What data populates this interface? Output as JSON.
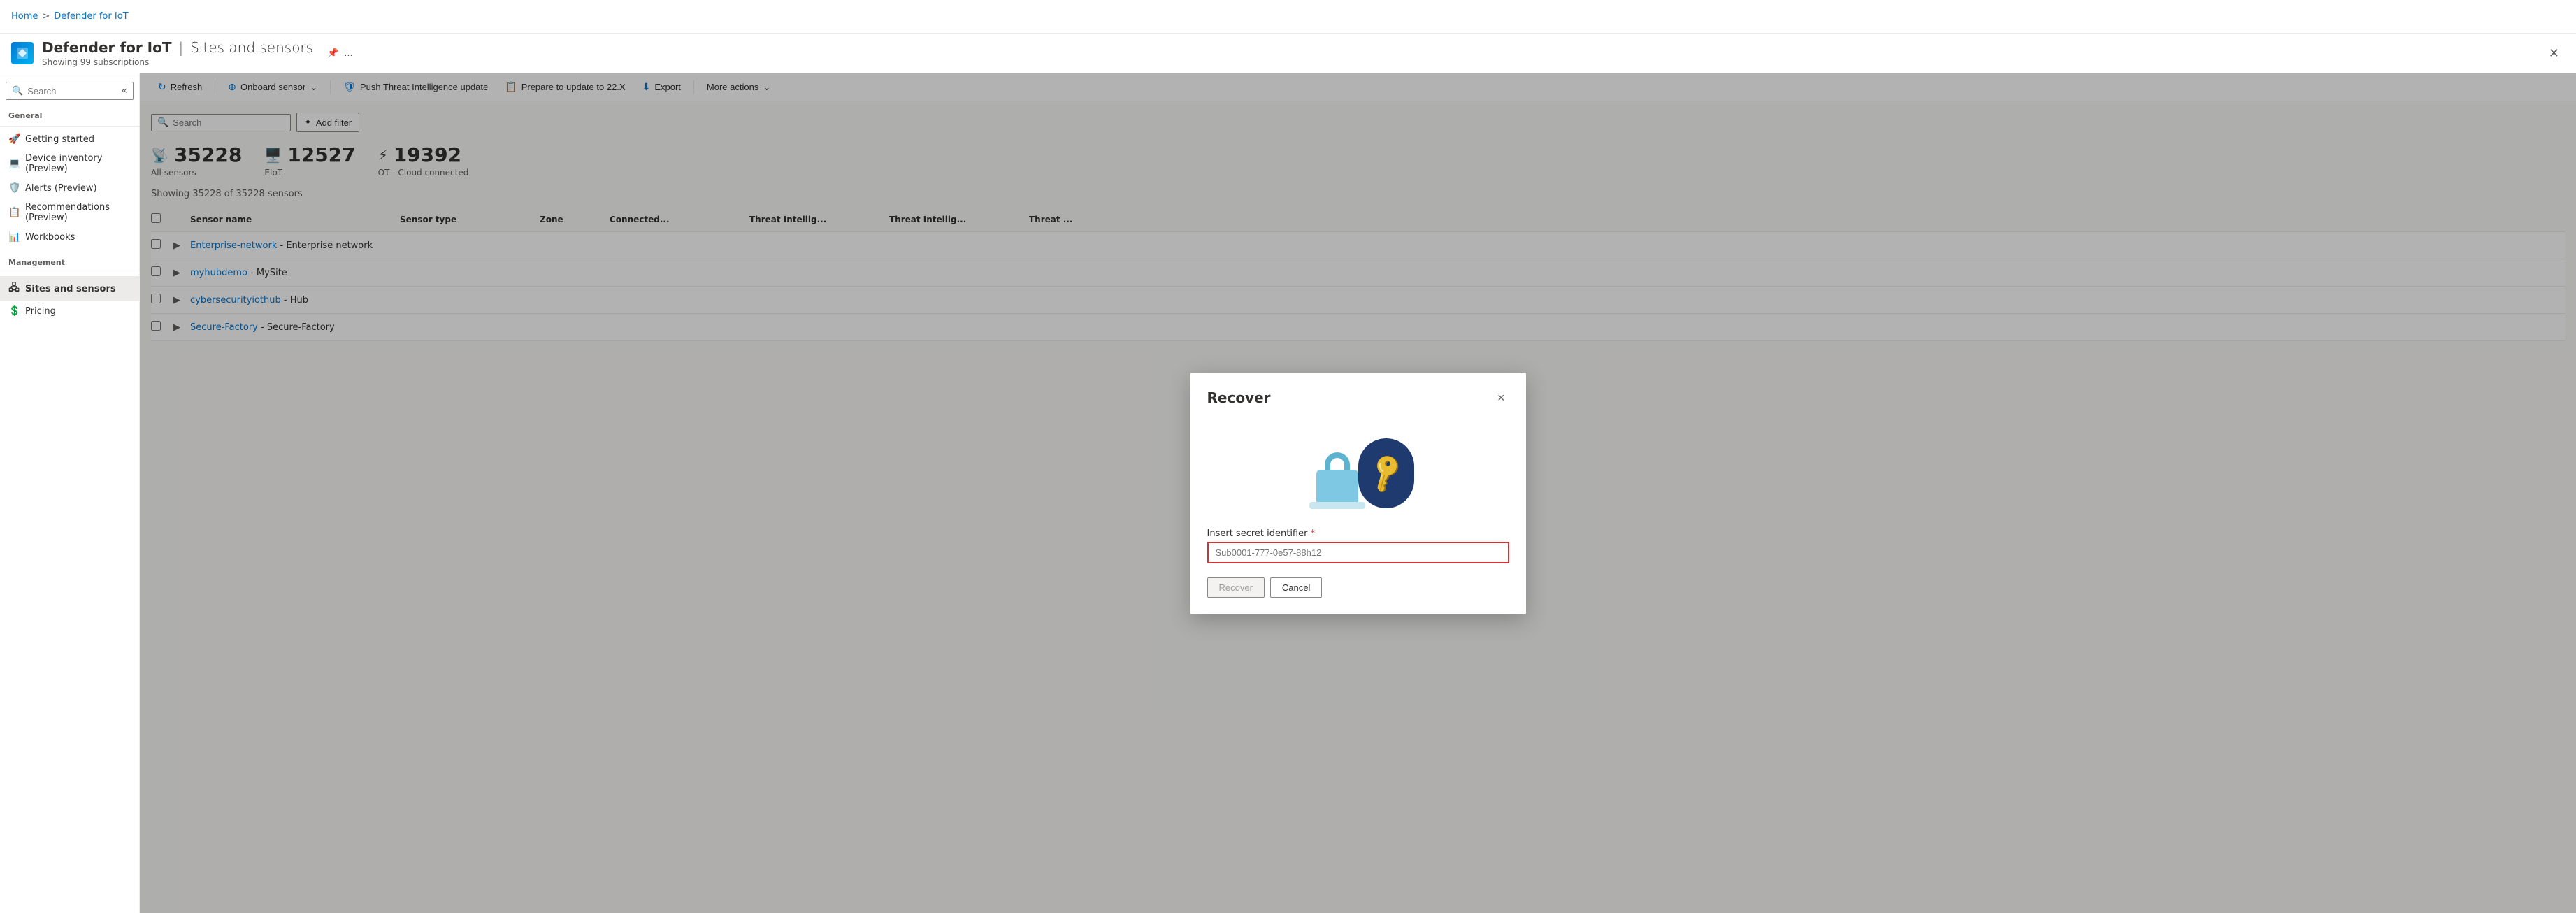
{
  "breadcrumb": {
    "home": "Home",
    "separator": ">",
    "current": "Defender for IoT"
  },
  "appTitle": {
    "name": "Defender for IoT",
    "divider": "|",
    "subtitle": "Sites and sensors",
    "subscriptions": "Showing 99 subscriptions",
    "pinIcon": "📌",
    "moreIcon": "..."
  },
  "toolbar": {
    "refresh": "Refresh",
    "onboardSensor": "Onboard sensor",
    "pushThreatIntel": "Push Threat Intelligence update",
    "prepareUpdate": "Prepare to update to 22.X",
    "export": "Export",
    "moreActions": "More actions"
  },
  "sidebar": {
    "searchPlaceholder": "Search",
    "sections": {
      "general": "General",
      "management": "Management"
    },
    "items": [
      {
        "id": "getting-started",
        "label": "Getting started",
        "icon": "🚀"
      },
      {
        "id": "device-inventory",
        "label": "Device inventory (Preview)",
        "icon": "💻"
      },
      {
        "id": "alerts",
        "label": "Alerts (Preview)",
        "icon": "🛡️"
      },
      {
        "id": "recommendations",
        "label": "Recommendations (Preview)",
        "icon": "📋"
      },
      {
        "id": "workbooks",
        "label": "Workbooks",
        "icon": "📊"
      },
      {
        "id": "sites-sensors",
        "label": "Sites and sensors",
        "icon": "🖧",
        "active": true
      },
      {
        "id": "pricing",
        "label": "Pricing",
        "icon": "💲"
      }
    ]
  },
  "filterBar": {
    "searchPlaceholder": "Search",
    "addFilterLabel": "Add filter",
    "addFilterIcon": "+"
  },
  "stats": [
    {
      "icon": "📡",
      "count": "35228",
      "label": "All sensors"
    },
    {
      "icon": "🖥️",
      "count": "12527",
      "label": "EIoT"
    },
    {
      "icon": "⚡",
      "count": "19392",
      "label": "OT - Cloud connected"
    }
  ],
  "showing": "Showing 35228 of 35228 sensors",
  "table": {
    "columns": [
      "",
      "",
      "Sensor name",
      "Sensor type",
      "Zone",
      "Connected...",
      "Threat Intellig...",
      "Threat Intellig...",
      "Threat ..."
    ],
    "rows": [
      {
        "name": "Enterprise-network",
        "nameSuffix": "Enterprise network",
        "type": "",
        "zone": ""
      },
      {
        "name": "myhubdemo",
        "nameSuffix": "MySite",
        "type": "",
        "zone": ""
      },
      {
        "name": "cybersecurityiothub",
        "nameSuffix": "Hub",
        "type": "",
        "zone": ""
      },
      {
        "name": "Secure-Factory",
        "nameSuffix": "Secure-Factory",
        "type": "",
        "zone": ""
      }
    ]
  },
  "modal": {
    "title": "Recover",
    "closeLabel": "×",
    "fieldLabel": "Insert secret identifier",
    "fieldRequired": "*",
    "fieldPlaceholder": "Sub0001-777-0e57-88h12",
    "recoverButton": "Recover",
    "cancelButton": "Cancel"
  }
}
